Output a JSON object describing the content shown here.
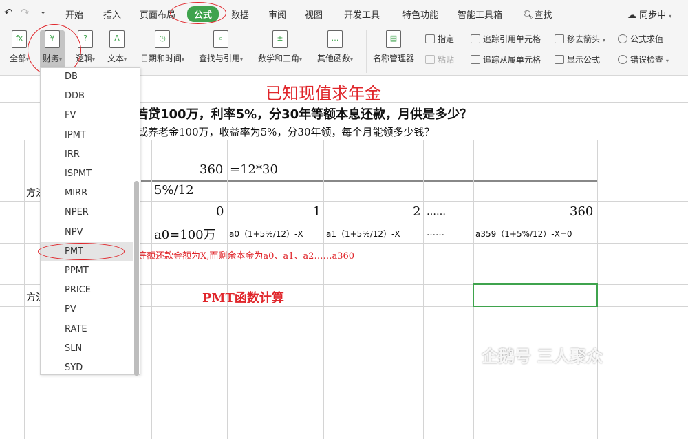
{
  "menubar": {
    "tabs": [
      "开始",
      "插入",
      "页面布局",
      "公式",
      "数据",
      "审阅",
      "视图",
      "开发工具",
      "特色功能",
      "智能工具箱"
    ],
    "search": "查找",
    "sync": "同步中"
  },
  "ribbon": {
    "groups": [
      "全部",
      "财务",
      "逻辑",
      "文本",
      "日期和时间",
      "查找与引用",
      "数学和三角",
      "其他函数"
    ],
    "name_manager": "名称管理器",
    "assign": "指定",
    "paste": "粘贴",
    "trace_precedents": "追踪引用单元格",
    "trace_dependents": "追踪从属单元格",
    "remove_arrows": "移去箭头",
    "show_formulas": "显示公式",
    "evaluate_formula": "公式求值",
    "error_check": "错误检查"
  },
  "dropdown": {
    "items": [
      "DB",
      "DDB",
      "FV",
      "IPMT",
      "IRR",
      "ISPMT",
      "MIRR",
      "NPER",
      "NPV",
      "PMT",
      "PPMT",
      "PRICE",
      "PV",
      "RATE",
      "SLN",
      "SYD"
    ],
    "selected": "PMT"
  },
  "sheet": {
    "title": "已知现值求年金",
    "q1": "若贷100万，利率5%，分30年等额本息还款，月供是多少？",
    "q2": "或养老金100万，收益率为5%，分30年领，每个月能领多少钱？",
    "n": "360",
    "n_formula": "=12*30",
    "method1": "方法",
    "rate": "5%/12",
    "periods": [
      "0",
      "1",
      "2",
      "……",
      "360"
    ],
    "balances": [
      "a0=100万",
      "a0（1+5%/12）-X",
      "a1（1+5%/12）-X",
      "……",
      "a359（1+5%/12）-X=0"
    ],
    "note": "等额还款金额为X,而剩余本金为a0、a1、a2……a360",
    "method2": "方法",
    "pmt_calc": "PMT函数计算"
  },
  "watermark": "企鹅号 三人聚众",
  "colors": {
    "accent": "#3fa34d",
    "red": "#e0262b"
  }
}
